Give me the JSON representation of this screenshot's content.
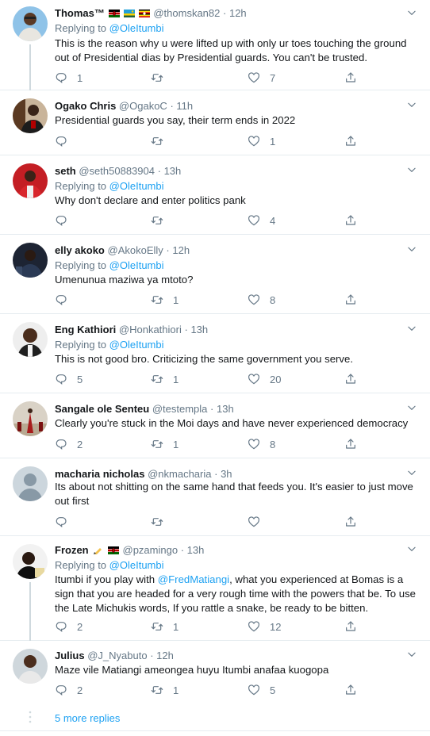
{
  "replying_prefix": "Replying to",
  "more_replies": "5 more replies",
  "tweets": [
    {
      "name": "Thomas",
      "name_suffix": "™",
      "handle": "@thomskan82",
      "time": "12h",
      "replying_to": "@OleItumbi",
      "text": "This is the reason why u were lifted up with only ur toes touching the ground out of Presidential dias by Presidential guards. You can't be trusted.",
      "replies": "1",
      "retweets": "",
      "likes": "7"
    },
    {
      "name": "Ogako Chris",
      "handle": "@OgakoC",
      "time": "11h",
      "text": "Presidential guards you say, their term ends in 2022",
      "replies": "",
      "retweets": "",
      "likes": "1"
    },
    {
      "name": "seth",
      "handle": "@seth50883904",
      "time": "13h",
      "replying_to": "@OleItumbi",
      "text": "Why don't declare and enter politics pank",
      "replies": "",
      "retweets": "",
      "likes": "4"
    },
    {
      "name": "elly akoko",
      "handle": "@AkokoElly",
      "time": "12h",
      "replying_to": "@OleItumbi",
      "text": "Umenunua maziwa ya mtoto?",
      "replies": "",
      "retweets": "1",
      "likes": "8"
    },
    {
      "name": "Eng Kathiori",
      "handle": "@Honkathiori",
      "time": "13h",
      "replying_to": "@OleItumbi",
      "text": "This is not good bro. Criticizing the same government you serve.",
      "replies": "5",
      "retweets": "1",
      "likes": "20"
    },
    {
      "name": "Sangale ole Senteu",
      "handle": "@testempla",
      "time": "13h",
      "text": "Clearly you're stuck in the Moi days and have never experienced democracy",
      "replies": "2",
      "retweets": "1",
      "likes": "8"
    },
    {
      "name": "macharia nicholas",
      "handle": "@nkmacharia",
      "time": "3h",
      "text": "Its about not shitting on the same hand that feeds you. It's easier to just move out first",
      "replies": "",
      "retweets": "",
      "likes": ""
    },
    {
      "name": "Frozen",
      "handle": "@pzamingo",
      "time": "13h",
      "replying_to": "@OleItumbi",
      "text_before": "Itumbi if you play with ",
      "text_mention": "@FredMatiangi",
      "text_after": ", what you experienced at Bomas is a sign that you are headed for a very rough time with the powers that be. To use the Late Michukis words, If you rattle a snake, be ready to be bitten.",
      "replies": "2",
      "retweets": "1",
      "likes": "12"
    },
    {
      "name": "Julius",
      "handle": "@J_Nyabuto",
      "time": "12h",
      "text": "Maze vile Matiangi ameongea huyu Itumbi anafaa kuogopa",
      "replies": "2",
      "retweets": "1",
      "likes": "5"
    }
  ],
  "icons": {
    "reply": "reply-icon",
    "retweet": "retweet-icon",
    "like": "heart-icon",
    "share": "share-icon",
    "caret": "chevron-down-icon"
  },
  "colors": {
    "link": "#1da1f2",
    "secondary_text": "#657786",
    "icon": "#657786",
    "divider": "#e6ecf0"
  }
}
